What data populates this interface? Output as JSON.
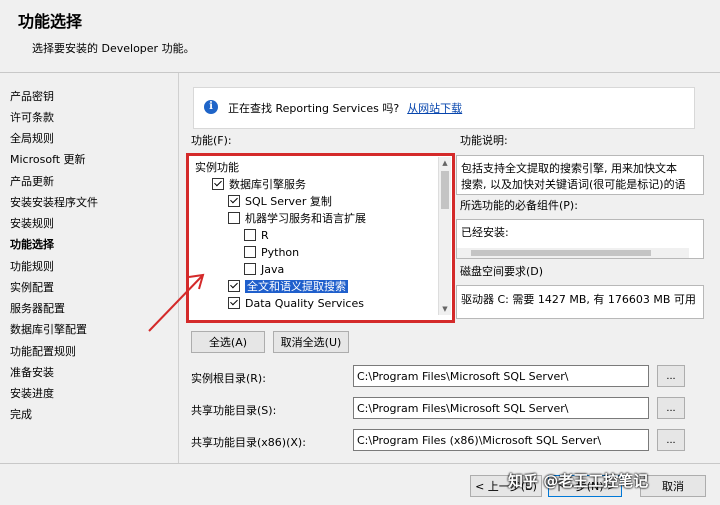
{
  "header": {
    "title": "功能选择",
    "subtitle": "选择要安装的 Developer 功能。"
  },
  "sidebar": {
    "items": [
      {
        "label": "产品密钥"
      },
      {
        "label": "许可条款"
      },
      {
        "label": "全局规则"
      },
      {
        "label": "Microsoft 更新"
      },
      {
        "label": "产品更新"
      },
      {
        "label": "安装安装程序文件"
      },
      {
        "label": "安装规则"
      },
      {
        "label": "功能选择"
      },
      {
        "label": "功能规则"
      },
      {
        "label": "实例配置"
      },
      {
        "label": "服务器配置"
      },
      {
        "label": "数据库引擎配置"
      },
      {
        "label": "功能配置规则"
      },
      {
        "label": "准备安装"
      },
      {
        "label": "安装进度"
      },
      {
        "label": "完成"
      }
    ],
    "active_index": 7
  },
  "info": {
    "text": "正在查找 Reporting Services 吗?",
    "link": "从网站下载"
  },
  "features": {
    "label": "功能(F):",
    "items": [
      {
        "label": "实例功能",
        "checkbox": false
      },
      {
        "label": "数据库引擎服务",
        "checkbox": true,
        "checked": true
      },
      {
        "label": "SQL Server 复制",
        "checkbox": true,
        "checked": true
      },
      {
        "label": "机器学习服务和语言扩展",
        "checkbox": true,
        "checked": false
      },
      {
        "label": "R",
        "checkbox": true,
        "checked": false
      },
      {
        "label": "Python",
        "checkbox": true,
        "checked": false
      },
      {
        "label": "Java",
        "checkbox": true,
        "checked": false
      },
      {
        "label": "全文和语义提取搜索",
        "checkbox": true,
        "checked": true,
        "highlighted": true
      },
      {
        "label": "Data Quality Services",
        "checkbox": true,
        "checked": true
      }
    ]
  },
  "description": {
    "label": "功能说明:",
    "lines": [
      "包括支持全文提取的搜索引擎, 用来加快文本",
      "搜索, 以及加快对关键语词(很可能是标记)的语"
    ]
  },
  "prereq": {
    "label": "所选功能的必备组件(P):",
    "text": "已经安装:"
  },
  "disk": {
    "label": "磁盘空间要求(D)",
    "text": "驱动器 C: 需要 1427 MB, 有 176603 MB 可用"
  },
  "buttons": {
    "select_all": "全选(A)",
    "deselect_all": "取消全选(U)"
  },
  "paths": [
    {
      "label": "实例根目录(R):",
      "value": "C:\\Program Files\\Microsoft SQL Server\\"
    },
    {
      "label": "共享功能目录(S):",
      "value": "C:\\Program Files\\Microsoft SQL Server\\"
    },
    {
      "label": "共享功能目录(x86)(X):",
      "value": "C:\\Program Files (x86)\\Microsoft SQL Server\\"
    }
  ],
  "browse_label": "...",
  "footer": {
    "back": "< 上一步(B)",
    "next": "下一步(N) >",
    "cancel": "取消"
  },
  "watermark": "知乎 @老王工控笔记",
  "colors": {
    "highlight": "#d42a2a",
    "selection": "#1f5fcc",
    "link": "#0645ad"
  }
}
